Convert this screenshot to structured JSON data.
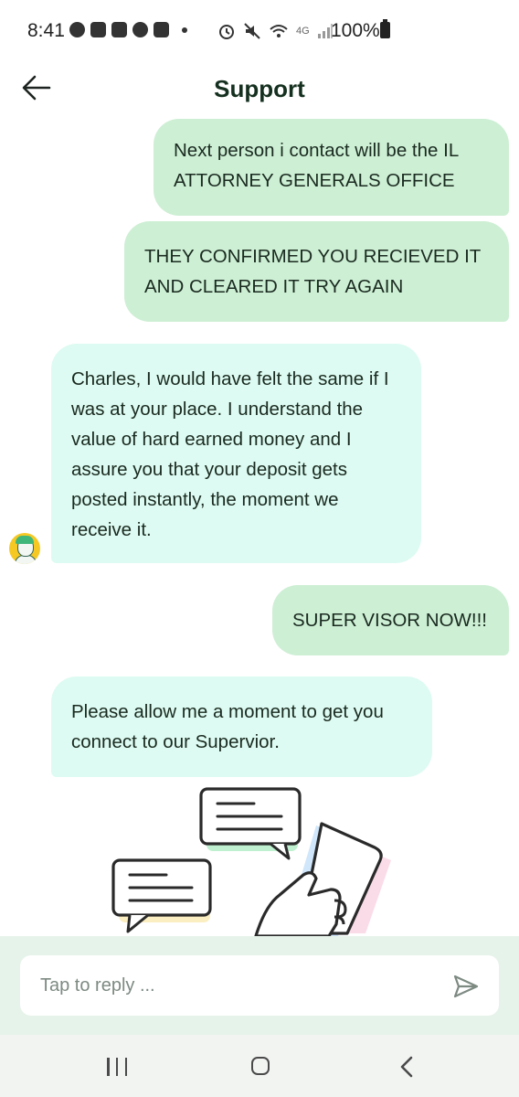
{
  "status_bar": {
    "time": "8:41",
    "network": "4G",
    "battery": "100%"
  },
  "header": {
    "title": "Support",
    "back_icon": "arrow-left-icon"
  },
  "messages": [
    {
      "direction": "outgoing",
      "text": "Next person i contact will be the IL ATTORNEY GENERALS OFFICE"
    },
    {
      "direction": "outgoing",
      "text": "THEY CONFIRMED YOU RECIEVED IT AND CLEARED IT TRY AGAIN"
    },
    {
      "direction": "incoming",
      "text": "Charles, I would have felt the same if I was at your place. I understand the value of hard earned money and I assure you that your deposit gets posted instantly, the moment we receive it."
    },
    {
      "direction": "outgoing",
      "text": "SUPER VISOR NOW!!!"
    },
    {
      "direction": "incoming",
      "text": "Please allow me a moment to get you connect to our Supervior."
    }
  ],
  "composer": {
    "placeholder": "Tap to reply ...",
    "send_icon": "send-icon"
  },
  "colors": {
    "outgoing_bubble": "#cdefd4",
    "incoming_bubble": "#ddfbf2",
    "composer_background": "#e6f3ea",
    "title_text": "#15301f"
  },
  "navigation_bar": {
    "icons": [
      "recent-apps-icon",
      "home-icon",
      "back-icon"
    ]
  }
}
